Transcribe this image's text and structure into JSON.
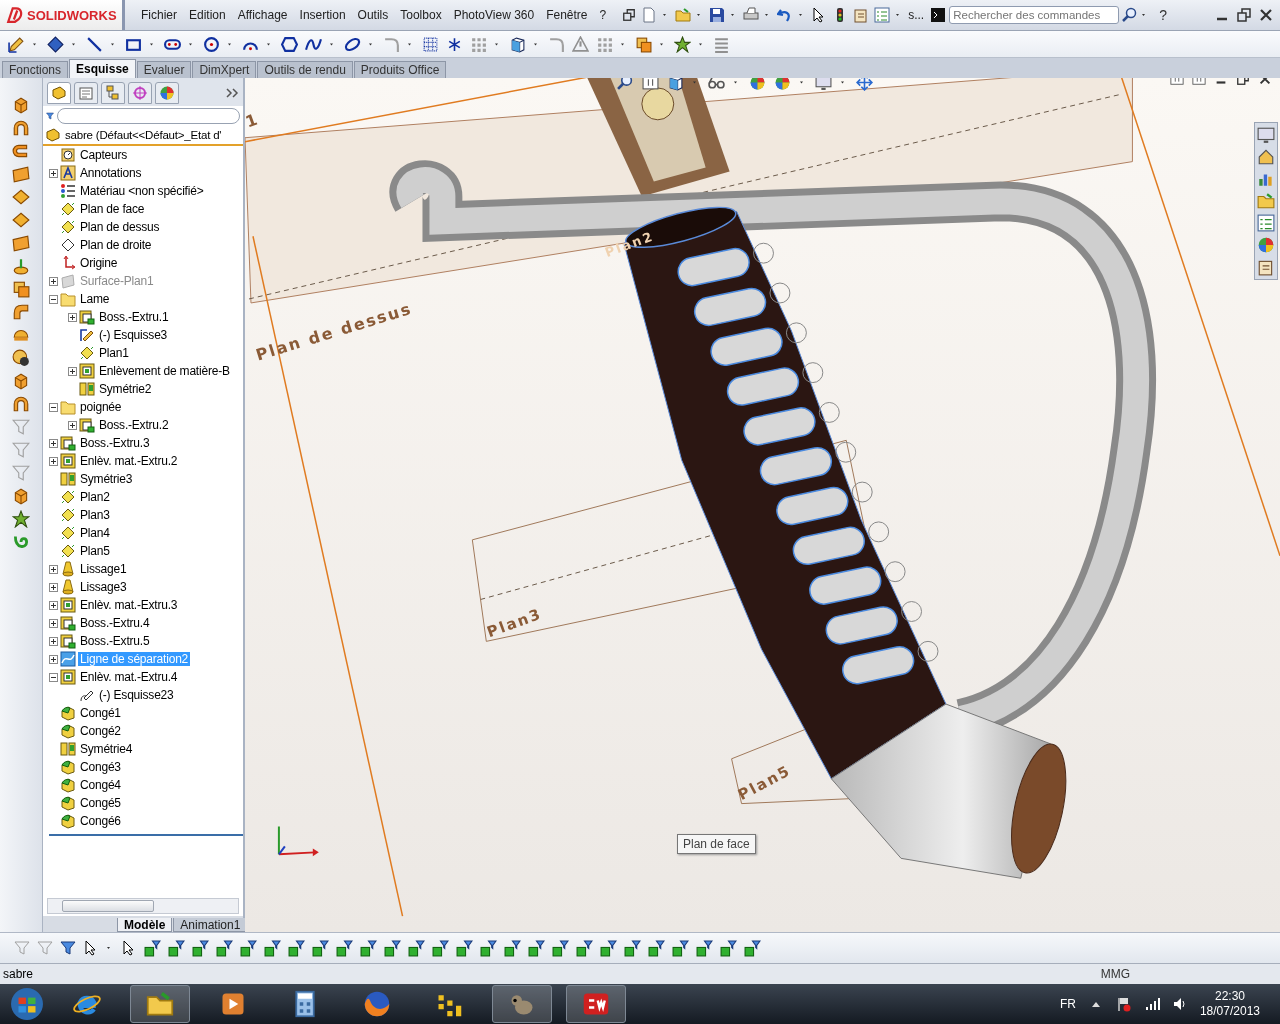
{
  "app": {
    "logo_text": "SOLIDWORKS"
  },
  "menu": [
    "Fichier",
    "Edition",
    "Affichage",
    "Insertion",
    "Outils",
    "Toolbox",
    "PhotoView 360",
    "Fenêtre",
    "?"
  ],
  "toolbar_overflow": "s...",
  "search": {
    "placeholder": "Rechercher des commandes"
  },
  "help": "?",
  "command_tabs": [
    {
      "label": "Fonctions",
      "selected": false
    },
    {
      "label": "Esquisse",
      "selected": true
    },
    {
      "label": "Evaluer",
      "selected": false
    },
    {
      "label": "DimXpert",
      "selected": false
    },
    {
      "label": "Outils de rendu",
      "selected": false
    },
    {
      "label": "Produits Office",
      "selected": false
    }
  ],
  "feature_tree": {
    "root": "sabre  (Défaut<<Défaut>_Etat d'",
    "items": [
      {
        "kind": "sensor",
        "label": "Capteurs",
        "selected": false,
        "disabled": false
      },
      {
        "kind": "annotation",
        "label": "Annotations",
        "expanded": false,
        "selected": false,
        "disabled": false
      },
      {
        "kind": "material",
        "label": "Matériau <non spécifié>",
        "selected": false,
        "disabled": false
      },
      {
        "kind": "plane",
        "label": "Plan de face",
        "selected": false,
        "disabled": false
      },
      {
        "kind": "plane",
        "label": "Plan de dessus",
        "selected": false,
        "disabled": false
      },
      {
        "kind": "hidden",
        "label": "Plan de droite",
        "selected": false,
        "disabled": false
      },
      {
        "kind": "origin",
        "label": "Origine",
        "selected": false,
        "disabled": false
      },
      {
        "kind": "surface",
        "label": "Surface-Plan1",
        "expanded": false,
        "selected": false,
        "disabled": true
      },
      {
        "kind": "folder",
        "label": "Lame",
        "expanded": true,
        "selected": false,
        "disabled": false,
        "children": [
          {
            "kind": "boss",
            "label": "Boss.-Extru.1",
            "expanded": false,
            "selected": false,
            "disabled": false
          },
          {
            "kind": "sketch",
            "label": "(-) Esquisse3",
            "selected": false,
            "disabled": false
          },
          {
            "kind": "plane",
            "label": "Plan1",
            "selected": false,
            "disabled": false
          },
          {
            "kind": "cut",
            "label": "Enlèvement de matière-B",
            "expanded": false,
            "selected": false,
            "disabled": false
          },
          {
            "kind": "mirror",
            "label": "Symétrie2",
            "selected": false,
            "disabled": false
          }
        ]
      },
      {
        "kind": "folder",
        "label": "poignée",
        "expanded": true,
        "selected": false,
        "disabled": false,
        "children": [
          {
            "kind": "boss",
            "label": "Boss.-Extru.2",
            "expanded": false,
            "selected": false,
            "disabled": false
          }
        ]
      },
      {
        "kind": "boss",
        "label": "Boss.-Extru.3",
        "expanded": false,
        "selected": false,
        "disabled": false
      },
      {
        "kind": "cut",
        "label": "Enlèv. mat.-Extru.2",
        "expanded": false,
        "selected": false,
        "disabled": false
      },
      {
        "kind": "mirror",
        "label": "Symétrie3",
        "selected": false,
        "disabled": false
      },
      {
        "kind": "plane",
        "label": "Plan2",
        "selected": false,
        "disabled": false
      },
      {
        "kind": "plane",
        "label": "Plan3",
        "selected": false,
        "disabled": false
      },
      {
        "kind": "plane",
        "label": "Plan4",
        "selected": false,
        "disabled": false
      },
      {
        "kind": "plane",
        "label": "Plan5",
        "selected": false,
        "disabled": false
      },
      {
        "kind": "loft",
        "label": "Lissage1",
        "expanded": false,
        "selected": false,
        "disabled": false
      },
      {
        "kind": "loft",
        "label": "Lissage3",
        "expanded": false,
        "selected": false,
        "disabled": false
      },
      {
        "kind": "cut",
        "label": "Enlèv. mat.-Extru.3",
        "expanded": false,
        "selected": false,
        "disabled": false
      },
      {
        "kind": "boss",
        "label": "Boss.-Extru.4",
        "expanded": false,
        "selected": false,
        "disabled": false
      },
      {
        "kind": "boss",
        "label": "Boss.-Extru.5",
        "expanded": false,
        "selected": false,
        "disabled": false
      },
      {
        "kind": "split",
        "label": "Ligne de séparation2",
        "expanded": false,
        "selected": true,
        "disabled": false
      },
      {
        "kind": "cut",
        "label": "Enlèv. mat.-Extru.4",
        "expanded": true,
        "selected": false,
        "disabled": false,
        "children": [
          {
            "kind": "hidden-sketch",
            "label": "(-) Esquisse23",
            "selected": false,
            "disabled": false
          }
        ]
      },
      {
        "kind": "fillet",
        "label": "Congé1",
        "selected": false,
        "disabled": false
      },
      {
        "kind": "fillet",
        "label": "Congé2",
        "selected": false,
        "disabled": false
      },
      {
        "kind": "mirror",
        "label": "Symétrie4",
        "selected": false,
        "disabled": false
      },
      {
        "kind": "fillet",
        "label": "Congé3",
        "selected": false,
        "disabled": false
      },
      {
        "kind": "fillet",
        "label": "Congé4",
        "selected": false,
        "disabled": false
      },
      {
        "kind": "fillet",
        "label": "Congé5",
        "selected": false,
        "disabled": false
      },
      {
        "kind": "fillet",
        "label": "Congé6",
        "selected": false,
        "disabled": false
      }
    ]
  },
  "model_tabs": [
    {
      "label": "Modèle",
      "selected": true
    },
    {
      "label": "Animation1",
      "selected": false
    }
  ],
  "viewport": {
    "plane_labels": [
      "1",
      "Plan2",
      "Plan de dessus",
      "Plan3",
      "Plan5"
    ],
    "tooltip": "Plan de face"
  },
  "status_bar": {
    "document": "sabre",
    "units": "MMG"
  },
  "taskbar": {
    "language": "FR",
    "time": "22:30",
    "date": "18/07/2013"
  }
}
